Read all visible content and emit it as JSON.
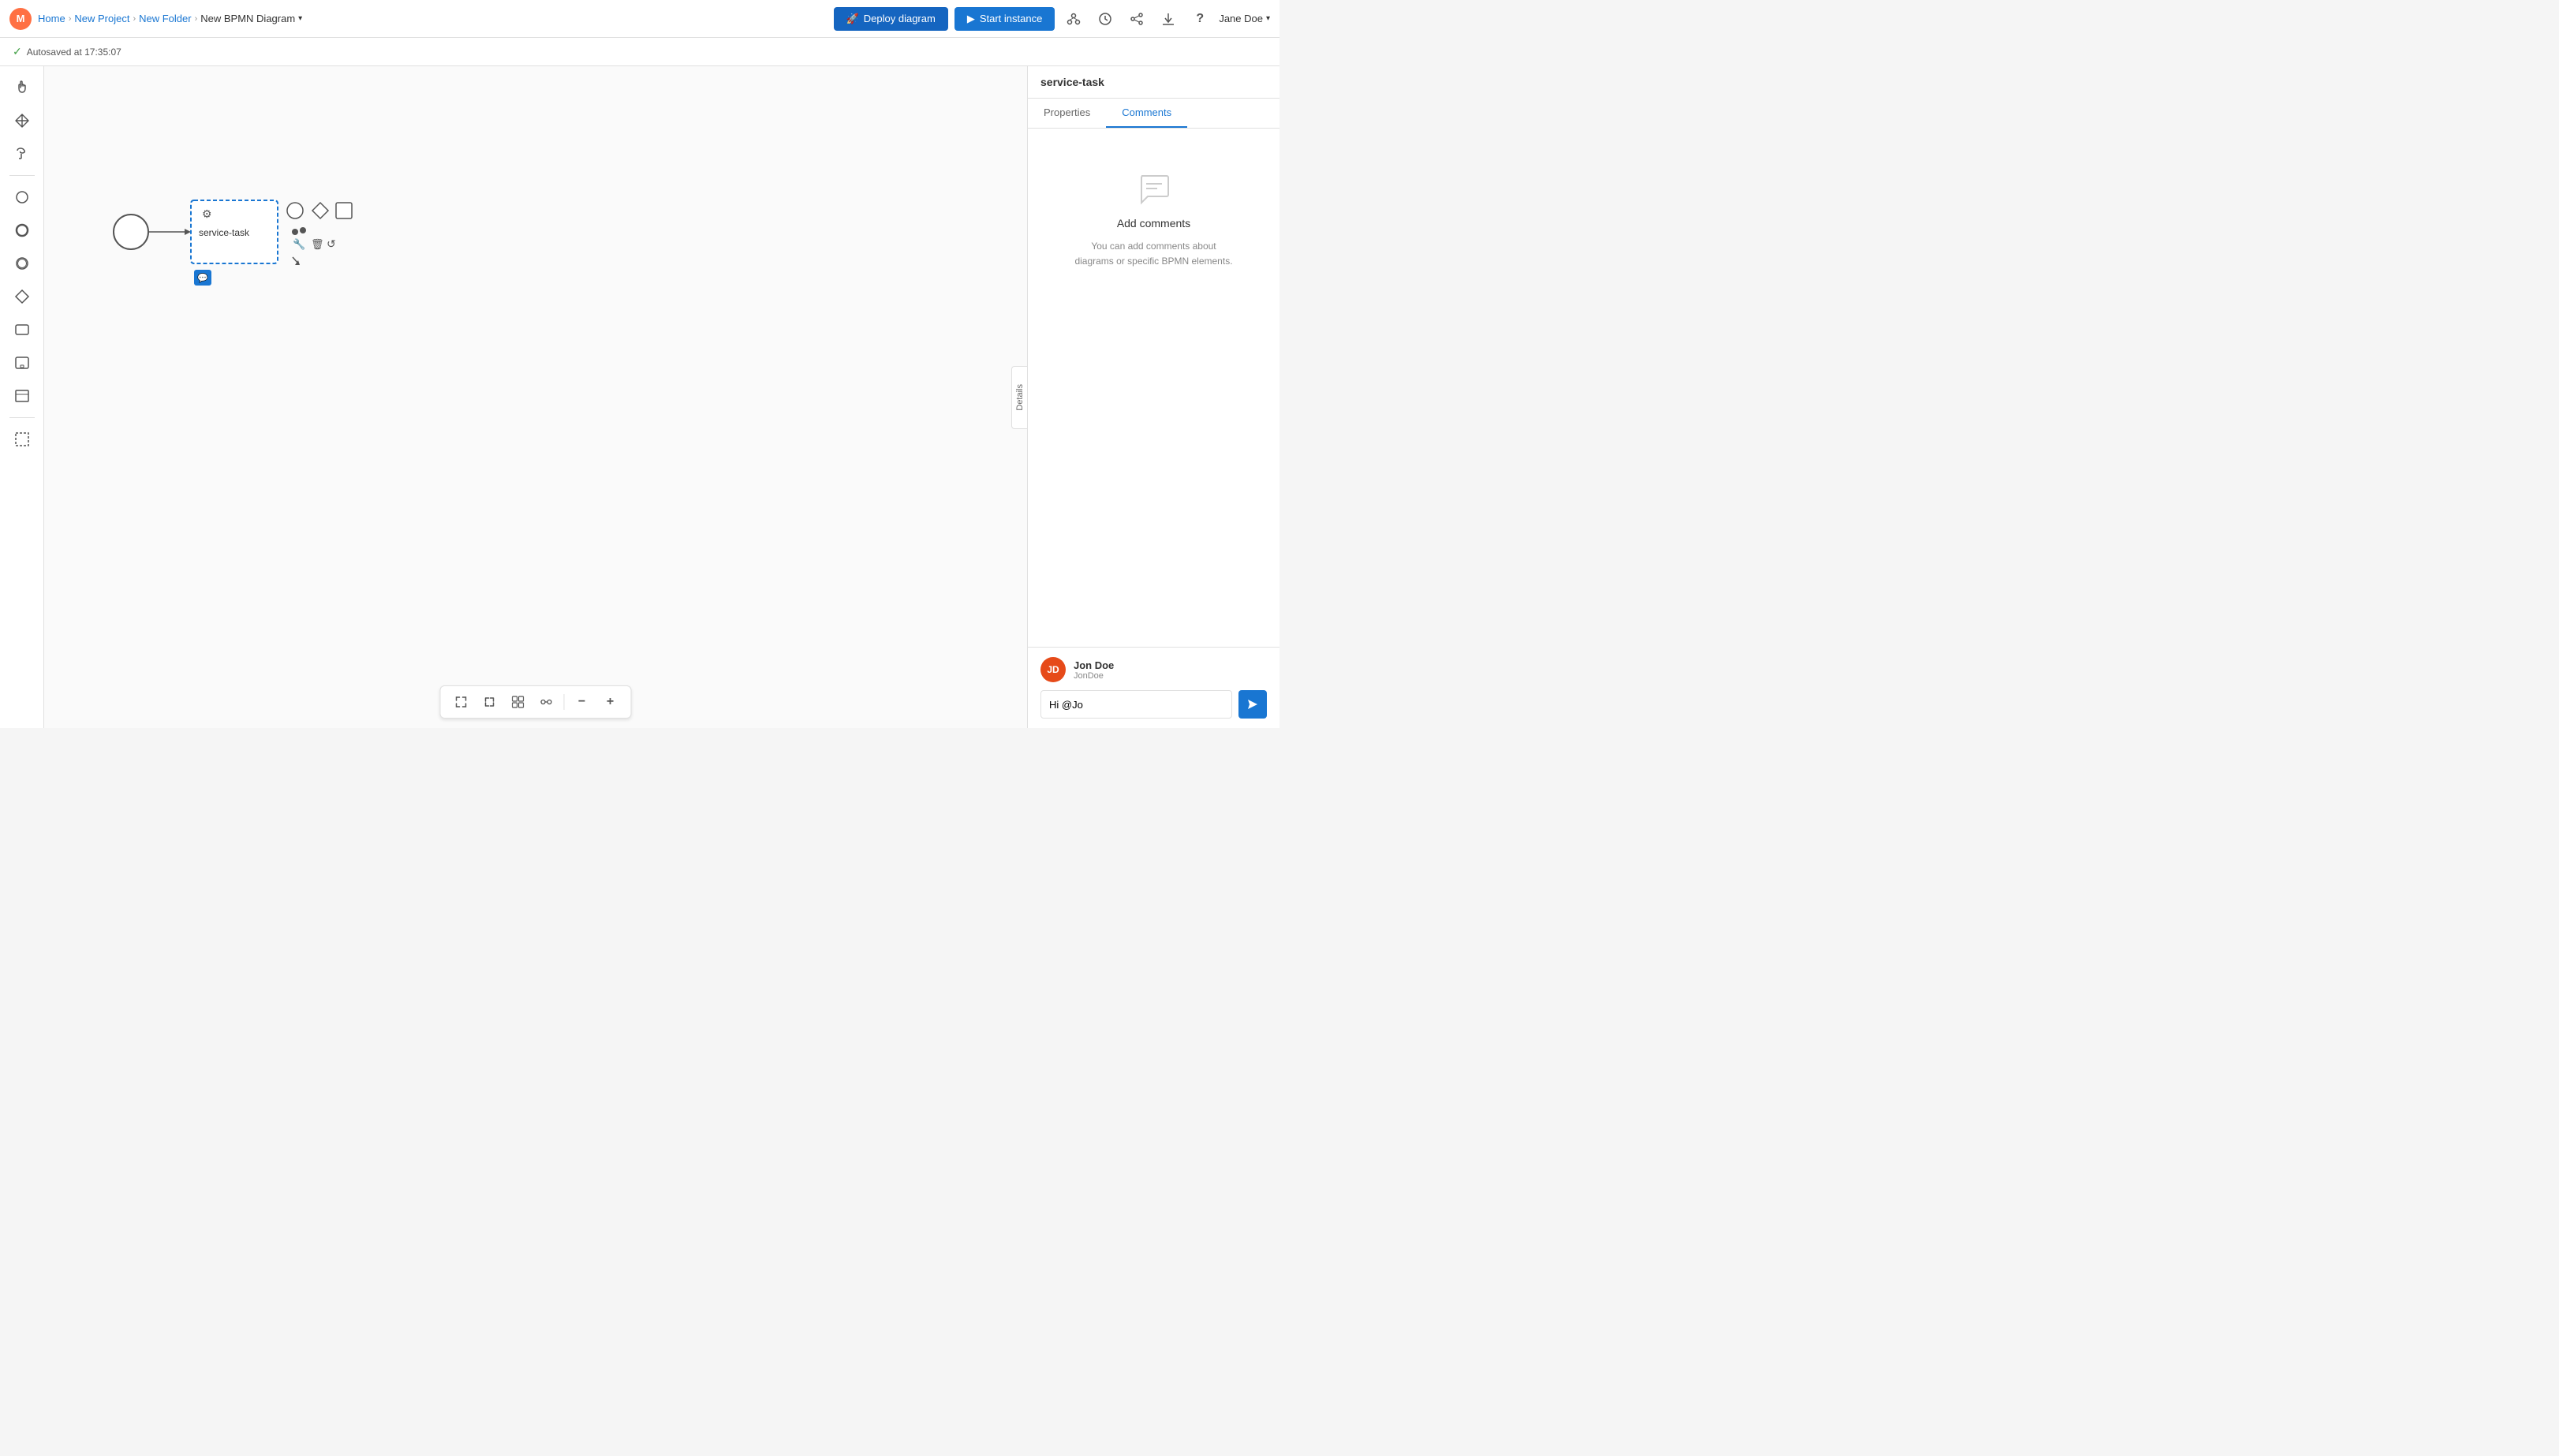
{
  "topbar": {
    "app_name": "Modeler",
    "breadcrumb": {
      "home": "Home",
      "project": "New Project",
      "folder": "New Folder",
      "diagram": "New BPMN Diagram"
    },
    "deploy_label": "Deploy diagram",
    "start_label": "Start instance",
    "user": "Jane Doe"
  },
  "autosave": {
    "text": "Autosaved at 17:35:07"
  },
  "panel": {
    "title": "service-task",
    "tab_properties": "Properties",
    "tab_comments": "Comments",
    "comments_title": "Add comments",
    "comments_desc": "You can add comments about\ndiagrams or specific BPMN elements.",
    "commenter": {
      "name": "Jon Doe",
      "handle": "JonDoe",
      "initials": "JD"
    },
    "comment_input_value": "Hi @Jo",
    "comment_input_placeholder": ""
  },
  "diagram": {
    "task_label": "service-task"
  },
  "details_panel": {
    "label": "Details"
  },
  "bottom_toolbar": {
    "fit_icon": "⤢",
    "fullscreen_icon": "⛶",
    "reset_icon": "⊞",
    "link_icon": "⬡",
    "zoom_out": "−",
    "zoom_in": "+"
  }
}
